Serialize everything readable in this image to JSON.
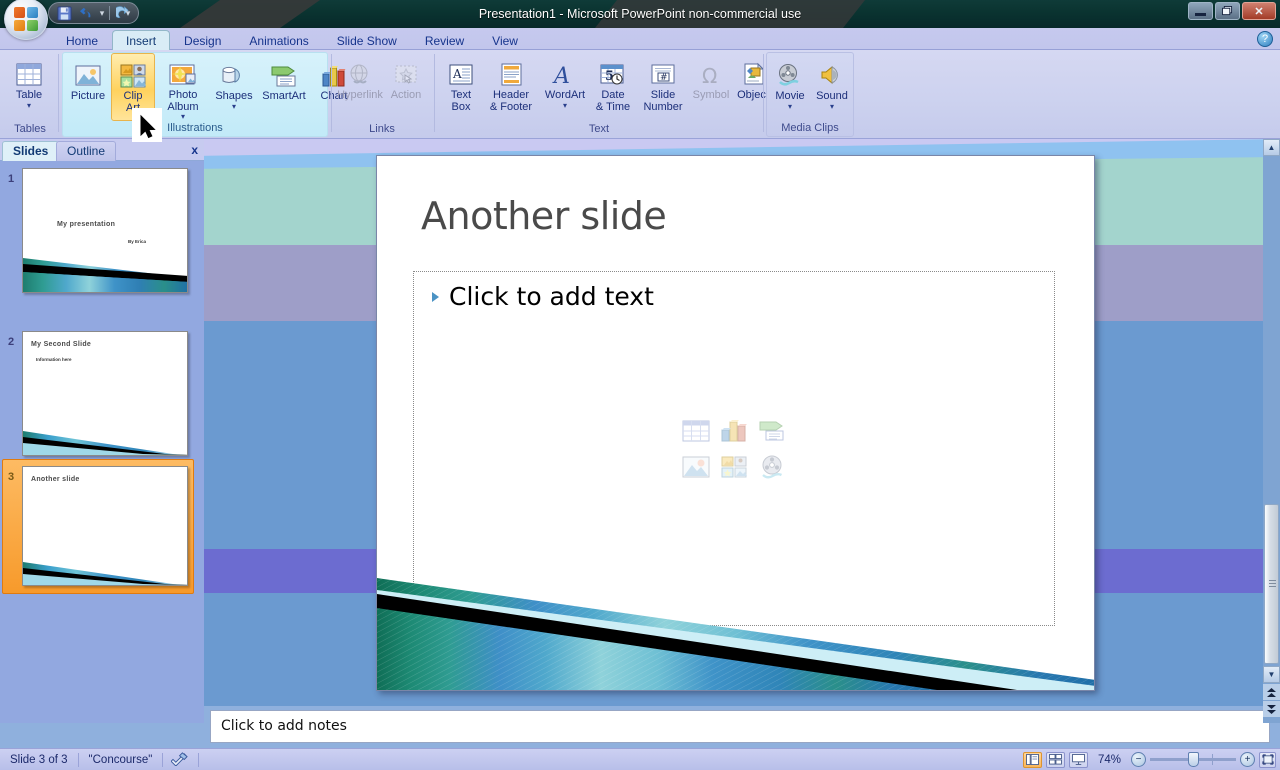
{
  "window": {
    "title": "Presentation1  -  Microsoft PowerPoint non-commercial use",
    "minimize_label": "—",
    "restore_label": "❐",
    "close_label": "✕",
    "orb_name": "office-button"
  },
  "quick_access": {
    "save_label": "save-icon",
    "undo_label": "undo-icon",
    "undo_dropdown_label": "▾",
    "redo_label": "redo-icon",
    "customize_label": "▾"
  },
  "ribbon": {
    "tabs": [
      {
        "label": "Home",
        "active": false
      },
      {
        "label": "Insert",
        "active": true
      },
      {
        "label": "Design",
        "active": false
      },
      {
        "label": "Animations",
        "active": false
      },
      {
        "label": "Slide Show",
        "active": false
      },
      {
        "label": "Review",
        "active": false
      },
      {
        "label": "View",
        "active": false
      }
    ],
    "help_label": "?",
    "groups": [
      {
        "name": "Tables",
        "label": "Tables",
        "highlight": false,
        "items": [
          {
            "label": "Table",
            "icon": "table-icon",
            "caret": true,
            "disabled": false
          }
        ]
      },
      {
        "name": "Illustrations",
        "label": "Illustrations",
        "highlight": true,
        "items": [
          {
            "label": "Picture",
            "icon": "picture-icon",
            "caret": false,
            "disabled": false
          },
          {
            "label": "Clip\nArt",
            "icon": "clipart-icon",
            "caret": false,
            "disabled": false,
            "hover": true
          },
          {
            "label": "Photo\nAlbum",
            "icon": "photo-album-icon",
            "caret": true,
            "disabled": false
          },
          {
            "label": "Shapes",
            "icon": "shapes-icon",
            "caret": true,
            "disabled": false
          },
          {
            "label": "SmartArt",
            "icon": "smartart-icon",
            "caret": false,
            "disabled": false
          },
          {
            "label": "Chart",
            "icon": "chart-icon",
            "caret": false,
            "disabled": false
          }
        ]
      },
      {
        "name": "Links",
        "label": "Links",
        "highlight": false,
        "items": [
          {
            "label": "Hyperlink",
            "icon": "hyperlink-icon",
            "caret": false,
            "disabled": true
          },
          {
            "label": "Action",
            "icon": "action-icon",
            "caret": false,
            "disabled": true
          }
        ]
      },
      {
        "name": "Text",
        "label": "Text",
        "highlight": false,
        "items": [
          {
            "label": "Text\nBox",
            "icon": "text-box-icon",
            "caret": false,
            "disabled": false
          },
          {
            "label": "Header\n& Footer",
            "icon": "header-footer-icon",
            "caret": false,
            "disabled": false
          },
          {
            "label": "WordArt",
            "icon": "wordart-icon",
            "caret": true,
            "disabled": false
          },
          {
            "label": "Date\n& Time",
            "icon": "date-time-icon",
            "caret": false,
            "disabled": false
          },
          {
            "label": "Slide\nNumber",
            "icon": "slide-number-icon",
            "caret": false,
            "disabled": false
          },
          {
            "label": "Symbol",
            "icon": "symbol-icon",
            "caret": false,
            "disabled": true
          },
          {
            "label": "Object",
            "icon": "object-icon",
            "caret": false,
            "disabled": false
          }
        ]
      },
      {
        "name": "Media Clips",
        "label": "Media Clips",
        "highlight": false,
        "items": [
          {
            "label": "Movie",
            "icon": "movie-icon",
            "caret": true,
            "disabled": false
          },
          {
            "label": "Sound",
            "icon": "sound-icon",
            "caret": true,
            "disabled": false
          }
        ]
      }
    ]
  },
  "slides_panel": {
    "tab_slides": "Slides",
    "tab_outline": "Outline",
    "close_label": "x",
    "thumbnails": [
      {
        "number": "1",
        "title": "My presentation",
        "subtitle": "By Erica",
        "bullet": "",
        "selected": false
      },
      {
        "number": "2",
        "title": "My Second Slide",
        "subtitle": "",
        "bullet": "Information here",
        "selected": false
      },
      {
        "number": "3",
        "title": "Another slide",
        "subtitle": "",
        "bullet": "",
        "selected": true
      }
    ]
  },
  "slide": {
    "title": "Another slide",
    "placeholder_text": "Click to add text",
    "content_icons": [
      "insert-table-icon",
      "insert-chart-icon",
      "insert-smartart-icon",
      "insert-picture-icon",
      "insert-clipart-icon",
      "insert-media-icon"
    ]
  },
  "notes": {
    "placeholder": "Click to add notes"
  },
  "status_bar": {
    "slide_counter": "Slide 3 of 3",
    "theme": "\"Concourse\"",
    "spellcheck_icon": "spellcheck-icon",
    "view_normal": "normal-view-icon",
    "view_sorter": "slide-sorter-icon",
    "view_show": "slide-show-icon",
    "zoom_level": "74%",
    "zoom_out_label": "−",
    "zoom_in_label": "+",
    "fit_label": "fit-slide-icon"
  },
  "scrollbars": {
    "up_arrow": "▲",
    "down_arrow": "▼",
    "prev_slide": "▲",
    "next_slide": "▼"
  },
  "theme_colors": {
    "accent_blue": "#4a8bc2",
    "accent_teal": "#2f9c92",
    "title_bar": "#0b3330",
    "ribbon": "#cdd2ef",
    "selection_orange": "#f79a2b"
  }
}
